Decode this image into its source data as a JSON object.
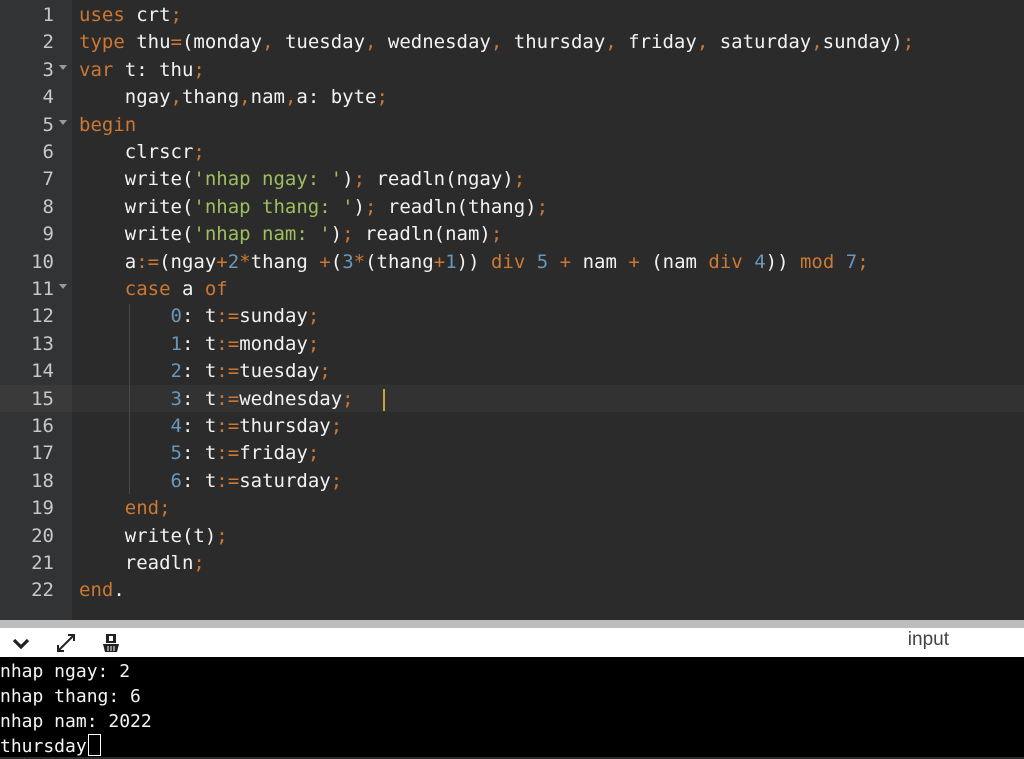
{
  "editor": {
    "lines": [
      {
        "num": "1",
        "fold": false,
        "tokens": [
          [
            "kw",
            "uses"
          ],
          [
            "plain",
            " crt"
          ],
          [
            "op",
            ";"
          ]
        ]
      },
      {
        "num": "2",
        "fold": false,
        "tokens": [
          [
            "kw",
            "type"
          ],
          [
            "plain",
            " thu"
          ],
          [
            "op",
            "="
          ],
          [
            "plain",
            "(monday"
          ],
          [
            "op",
            ","
          ],
          [
            "plain",
            " tuesday"
          ],
          [
            "op",
            ","
          ],
          [
            "plain",
            " wednesday"
          ],
          [
            "op",
            ","
          ],
          [
            "plain",
            " thursday"
          ],
          [
            "op",
            ","
          ],
          [
            "plain",
            " friday"
          ],
          [
            "op",
            ","
          ],
          [
            "plain",
            " saturday"
          ],
          [
            "op",
            ","
          ],
          [
            "plain",
            "sunday)"
          ],
          [
            "op",
            ";"
          ]
        ]
      },
      {
        "num": "3",
        "fold": true,
        "tokens": [
          [
            "kw",
            "var"
          ],
          [
            "plain",
            " t: thu"
          ],
          [
            "op",
            ";"
          ]
        ]
      },
      {
        "num": "4",
        "fold": false,
        "tokens": [
          [
            "plain",
            "    ngay"
          ],
          [
            "op",
            ","
          ],
          [
            "plain",
            "thang"
          ],
          [
            "op",
            ","
          ],
          [
            "plain",
            "nam"
          ],
          [
            "op",
            ","
          ],
          [
            "plain",
            "a: byte"
          ],
          [
            "op",
            ";"
          ]
        ]
      },
      {
        "num": "5",
        "fold": true,
        "tokens": [
          [
            "kw",
            "begin"
          ]
        ]
      },
      {
        "num": "6",
        "fold": false,
        "tokens": [
          [
            "plain",
            "    clrscr"
          ],
          [
            "op",
            ";"
          ]
        ]
      },
      {
        "num": "7",
        "fold": false,
        "tokens": [
          [
            "plain",
            "    write("
          ],
          [
            "str",
            "'nhap ngay: '"
          ],
          [
            "plain",
            ")"
          ],
          [
            "op",
            ";"
          ],
          [
            "plain",
            " readln(ngay)"
          ],
          [
            "op",
            ";"
          ]
        ]
      },
      {
        "num": "8",
        "fold": false,
        "tokens": [
          [
            "plain",
            "    write("
          ],
          [
            "str",
            "'nhap thang: '"
          ],
          [
            "plain",
            ")"
          ],
          [
            "op",
            ";"
          ],
          [
            "plain",
            " readln(thang)"
          ],
          [
            "op",
            ";"
          ]
        ]
      },
      {
        "num": "9",
        "fold": false,
        "tokens": [
          [
            "plain",
            "    write("
          ],
          [
            "str",
            "'nhap nam: '"
          ],
          [
            "plain",
            ")"
          ],
          [
            "op",
            ";"
          ],
          [
            "plain",
            " readln(nam)"
          ],
          [
            "op",
            ";"
          ]
        ]
      },
      {
        "num": "10",
        "fold": false,
        "tokens": [
          [
            "plain",
            "    a"
          ],
          [
            "op",
            ":="
          ],
          [
            "plain",
            "(ngay"
          ],
          [
            "op",
            "+"
          ],
          [
            "num",
            "2"
          ],
          [
            "op",
            "*"
          ],
          [
            "plain",
            "thang "
          ],
          [
            "op",
            "+"
          ],
          [
            "plain",
            "("
          ],
          [
            "num",
            "3"
          ],
          [
            "op",
            "*"
          ],
          [
            "plain",
            "(thang"
          ],
          [
            "op",
            "+"
          ],
          [
            "num",
            "1"
          ],
          [
            "plain",
            ")) "
          ],
          [
            "kw",
            "div"
          ],
          [
            "plain",
            " "
          ],
          [
            "num",
            "5"
          ],
          [
            "plain",
            " "
          ],
          [
            "op",
            "+"
          ],
          [
            "plain",
            " nam "
          ],
          [
            "op",
            "+"
          ],
          [
            "plain",
            " (nam "
          ],
          [
            "kw",
            "div"
          ],
          [
            "plain",
            " "
          ],
          [
            "num",
            "4"
          ],
          [
            "plain",
            ")) "
          ],
          [
            "kw",
            "mod"
          ],
          [
            "plain",
            " "
          ],
          [
            "num",
            "7"
          ],
          [
            "op",
            ";"
          ]
        ]
      },
      {
        "num": "11",
        "fold": true,
        "tokens": [
          [
            "plain",
            "    "
          ],
          [
            "kw",
            "case"
          ],
          [
            "plain",
            " a "
          ],
          [
            "kw",
            "of"
          ]
        ]
      },
      {
        "num": "12",
        "fold": false,
        "tokens": [
          [
            "plain",
            "        "
          ],
          [
            "num",
            "0"
          ],
          [
            "plain",
            ": t"
          ],
          [
            "op",
            ":="
          ],
          [
            "plain",
            "sunday"
          ],
          [
            "op",
            ";"
          ]
        ]
      },
      {
        "num": "13",
        "fold": false,
        "tokens": [
          [
            "plain",
            "        "
          ],
          [
            "num",
            "1"
          ],
          [
            "plain",
            ": t"
          ],
          [
            "op",
            ":="
          ],
          [
            "plain",
            "monday"
          ],
          [
            "op",
            ";"
          ]
        ]
      },
      {
        "num": "14",
        "fold": false,
        "tokens": [
          [
            "plain",
            "        "
          ],
          [
            "num",
            "2"
          ],
          [
            "plain",
            ": t"
          ],
          [
            "op",
            ":="
          ],
          [
            "plain",
            "tuesday"
          ],
          [
            "op",
            ";"
          ]
        ]
      },
      {
        "num": "15",
        "fold": false,
        "active": true,
        "tokens": [
          [
            "plain",
            "        "
          ],
          [
            "num",
            "3"
          ],
          [
            "plain",
            ": t"
          ],
          [
            "op",
            ":="
          ],
          [
            "plain",
            "wednesday"
          ],
          [
            "op",
            ";"
          ]
        ]
      },
      {
        "num": "16",
        "fold": false,
        "tokens": [
          [
            "plain",
            "        "
          ],
          [
            "num",
            "4"
          ],
          [
            "plain",
            ": t"
          ],
          [
            "op",
            ":="
          ],
          [
            "plain",
            "thursday"
          ],
          [
            "op",
            ";"
          ]
        ]
      },
      {
        "num": "17",
        "fold": false,
        "tokens": [
          [
            "plain",
            "        "
          ],
          [
            "num",
            "5"
          ],
          [
            "plain",
            ": t"
          ],
          [
            "op",
            ":="
          ],
          [
            "plain",
            "friday"
          ],
          [
            "op",
            ";"
          ]
        ]
      },
      {
        "num": "18",
        "fold": false,
        "tokens": [
          [
            "plain",
            "        "
          ],
          [
            "num",
            "6"
          ],
          [
            "plain",
            ": t"
          ],
          [
            "op",
            ":="
          ],
          [
            "plain",
            "saturday"
          ],
          [
            "op",
            ";"
          ]
        ]
      },
      {
        "num": "19",
        "fold": false,
        "tokens": [
          [
            "plain",
            "    "
          ],
          [
            "kw",
            "end"
          ],
          [
            "op",
            ";"
          ]
        ]
      },
      {
        "num": "20",
        "fold": false,
        "tokens": [
          [
            "plain",
            "    write(t)"
          ],
          [
            "op",
            ";"
          ]
        ]
      },
      {
        "num": "21",
        "fold": false,
        "tokens": [
          [
            "plain",
            "    readln"
          ],
          [
            "op",
            ";"
          ]
        ]
      },
      {
        "num": "22",
        "fold": false,
        "tokens": [
          [
            "kw",
            "end"
          ],
          [
            "plain",
            "."
          ]
        ]
      }
    ]
  },
  "panel": {
    "title": "input",
    "icons": [
      "chevron-down-icon",
      "expand-icon",
      "clear-icon"
    ]
  },
  "console": {
    "lines": [
      "nhap ngay: 2",
      "nhap thang: 6",
      "nhap nam: 2022",
      "thursday"
    ]
  },
  "colors": {
    "keyword": "#cc7832",
    "number": "#6897bb",
    "string": "#9fbf5f",
    "background": "#2b2b2b"
  }
}
